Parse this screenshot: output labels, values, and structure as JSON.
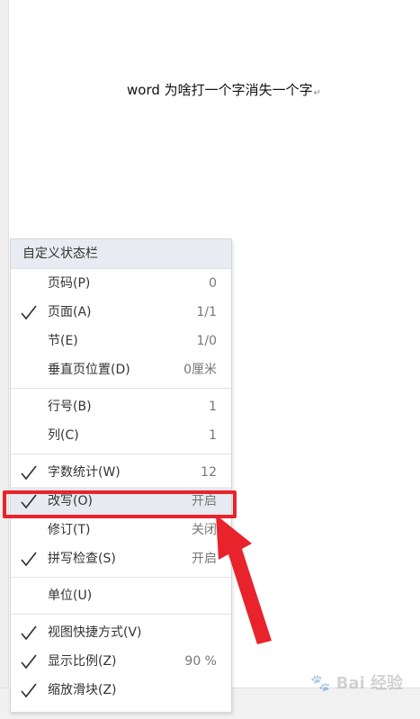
{
  "document": {
    "text": "word 为啥打一个字消失一个字",
    "para_mark": "↵"
  },
  "menu": {
    "title": "自定义状态栏",
    "groups": [
      [
        {
          "label": "页码(P)",
          "value": "0",
          "checked": false
        },
        {
          "label": "页面(A)",
          "value": "1/1",
          "checked": true
        },
        {
          "label": "节(E)",
          "value": "1/0",
          "checked": false
        },
        {
          "label": "垂直页位置(D)",
          "value": "0厘米",
          "checked": false
        }
      ],
      [
        {
          "label": "行号(B)",
          "value": "1",
          "checked": false
        },
        {
          "label": "列(C)",
          "value": "1",
          "checked": false
        }
      ],
      [
        {
          "label": "字数统计(W)",
          "value": "12",
          "checked": true
        },
        {
          "label": "改写(O)",
          "value": "开启",
          "checked": true,
          "selected": true
        },
        {
          "label": "修订(T)",
          "value": "关闭",
          "checked": false
        },
        {
          "label": "拼写检查(S)",
          "value": "开启",
          "checked": true
        }
      ],
      [
        {
          "label": "单位(U)",
          "value": "",
          "checked": false
        }
      ],
      [
        {
          "label": "视图快捷方式(V)",
          "value": "",
          "checked": true
        },
        {
          "label": "显示比例(Z)",
          "value": "90 %",
          "checked": true
        },
        {
          "label": "缩放滑块(Z)",
          "value": "",
          "checked": true
        }
      ]
    ]
  },
  "annotation": {
    "highlight_color": "#e8232c",
    "arrow_color": "#e8232c"
  },
  "watermark": {
    "text": "Bai 经验"
  },
  "icons": {
    "check": "check-icon",
    "arrow": "red-arrow-icon",
    "paw": "paw-icon"
  }
}
